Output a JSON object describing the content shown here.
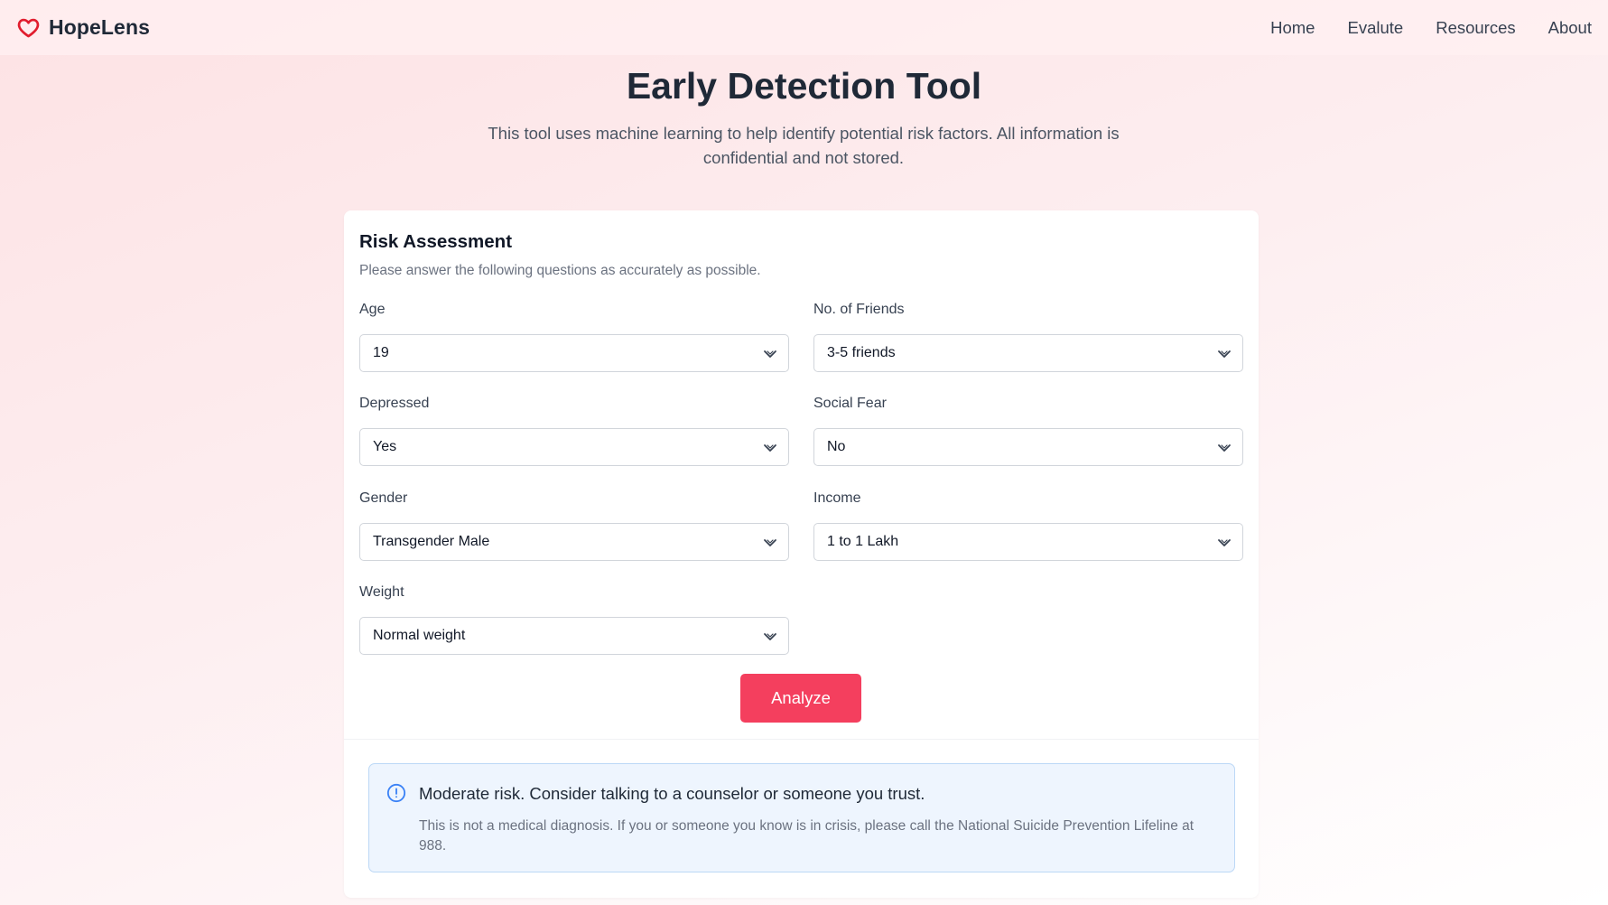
{
  "brand": {
    "name": "HopeLens",
    "icon": "heart-icon",
    "icon_color": "#e11d2e"
  },
  "nav": [
    {
      "label": "Home"
    },
    {
      "label": "Evalute"
    },
    {
      "label": "Resources"
    },
    {
      "label": "About"
    }
  ],
  "hero": {
    "title": "Early Detection Tool",
    "subtitle": "This tool uses machine learning to help identify potential risk factors. All information is confidential and not stored."
  },
  "form": {
    "title": "Risk Assessment",
    "description": "Please answer the following questions as accurately as possible.",
    "fields": {
      "age": {
        "label": "Age",
        "value": "19"
      },
      "friends": {
        "label": "No. of Friends",
        "value": "3-5 friends"
      },
      "depressed": {
        "label": "Depressed",
        "value": "Yes"
      },
      "social_fear": {
        "label": "Social Fear",
        "value": "No"
      },
      "gender": {
        "label": "Gender",
        "value": "Transgender Male"
      },
      "income": {
        "label": "Income",
        "value": "1 to 1 Lakh"
      },
      "weight": {
        "label": "Weight",
        "value": "Normal weight"
      }
    },
    "submit_label": "Analyze"
  },
  "result": {
    "icon": "info-circle-icon",
    "message": "Moderate risk. Consider talking to a counselor or someone you trust.",
    "disclaimer": "This is not a medical diagnosis. If you or someone you know is in crisis, please call the National Suicide Prevention Lifeline at 988."
  },
  "colors": {
    "accent": "#f43f5e",
    "info_border": "#bcd8f6",
    "info_background": "#eef5fe",
    "info_icon": "#3b82f6"
  }
}
